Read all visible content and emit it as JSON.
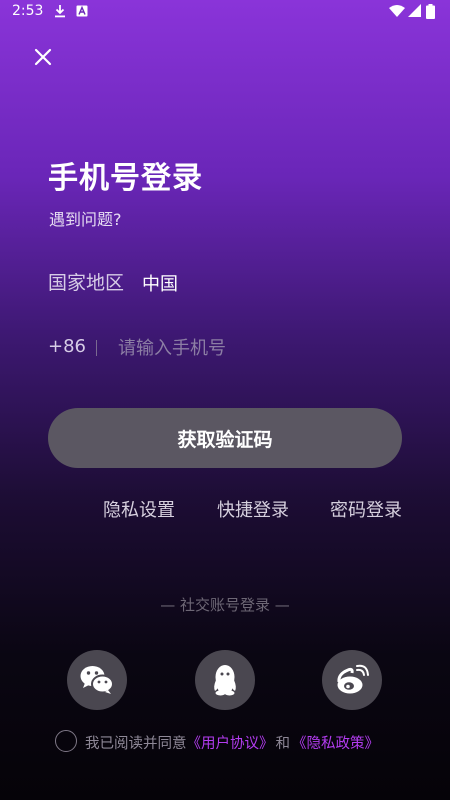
{
  "status_bar": {
    "time": "2:53"
  },
  "title": "手机号登录",
  "help_link": "遇到问题?",
  "region": {
    "label": "国家地区",
    "value": "中国"
  },
  "phone": {
    "country_code": "+86",
    "placeholder": "请输入手机号",
    "value": ""
  },
  "primary_button": "获取验证码",
  "options": [
    "隐私设置",
    "快捷登录",
    "密码登录"
  ],
  "social": {
    "title": "— 社交账号登录 —",
    "providers": [
      "wechat-icon",
      "qq-icon",
      "weibo-icon"
    ]
  },
  "agreement": {
    "prefix": "我已阅读并同意",
    "user_agreement": "《用户协议》",
    "and": "和",
    "privacy_policy": "《隐私政策》"
  },
  "colors": {
    "gradient_top": "#8a34d9",
    "gradient_bottom": "#050308",
    "button_bg": "#5b5762",
    "link": "#b33cf0"
  }
}
